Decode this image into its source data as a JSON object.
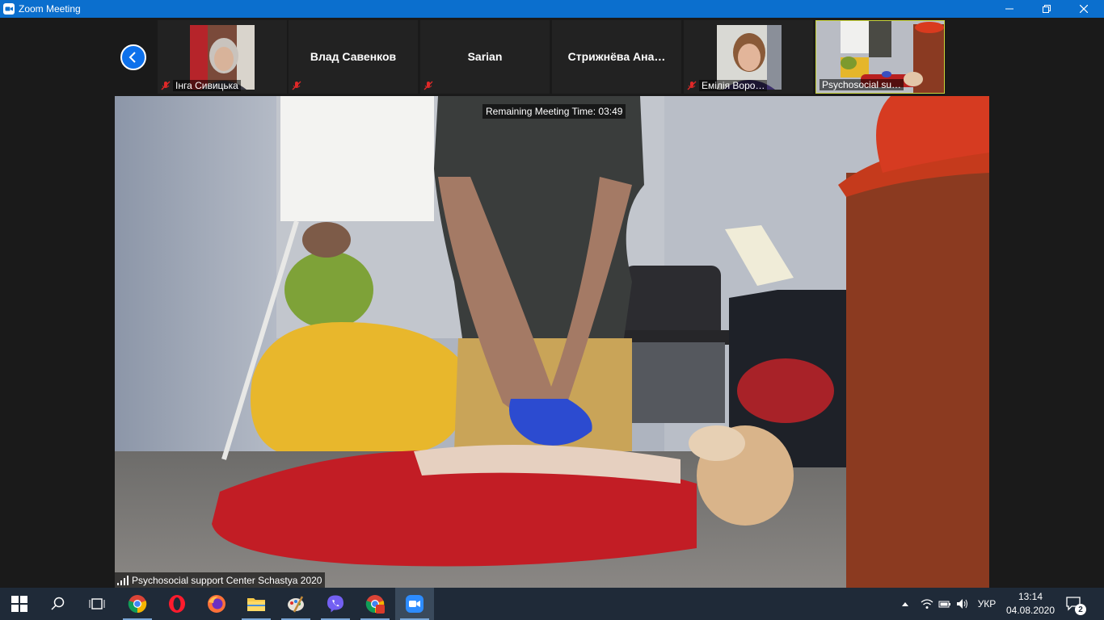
{
  "window": {
    "title": "Zoom Meeting",
    "minimize_glyph": "—",
    "restore_glyph": "❐",
    "close_glyph": "✕"
  },
  "gallery": {
    "participants": [
      {
        "name": "Інга Сивицька",
        "muted": true,
        "has_video": true
      },
      {
        "name": "Влад Савенков",
        "muted": true,
        "has_video": false
      },
      {
        "name": "Sarian",
        "muted": true,
        "has_video": false
      },
      {
        "name": "Стрижнёва  Ана…",
        "muted": false,
        "has_video": false
      },
      {
        "name": "Емілія Воро…",
        "muted": true,
        "has_video": true
      },
      {
        "name": "Psychosocial su…",
        "muted": false,
        "has_video": true,
        "active_speaker": true
      }
    ]
  },
  "meeting": {
    "remaining_time": "Remaining Meeting Time: 03:49",
    "speaker_label": "Psychosocial support Center Schastya 2020"
  },
  "taskbar": {
    "apps": [
      {
        "name": "start",
        "icon": "windows-logo-icon"
      },
      {
        "name": "search",
        "icon": "search-icon"
      },
      {
        "name": "task-view",
        "icon": "task-view-icon"
      },
      {
        "name": "chrome",
        "icon": "chrome-icon"
      },
      {
        "name": "opera",
        "icon": "opera-icon"
      },
      {
        "name": "firefox",
        "icon": "firefox-icon"
      },
      {
        "name": "file-explorer",
        "icon": "folder-icon"
      },
      {
        "name": "paint",
        "icon": "paint-palette-icon"
      },
      {
        "name": "viber",
        "icon": "viber-icon"
      },
      {
        "name": "chrome-profile",
        "icon": "chrome-icon"
      },
      {
        "name": "zoom",
        "icon": "zoom-icon"
      }
    ],
    "language": "УКР",
    "time": "13:14",
    "date": "04.08.2020",
    "notification_count": "2"
  },
  "colors": {
    "titlebar": "#0b6fce",
    "zoom_blue": "#0e71eb",
    "taskbar": "#1f2a38",
    "active_speaker_border": "#c8d43a"
  }
}
